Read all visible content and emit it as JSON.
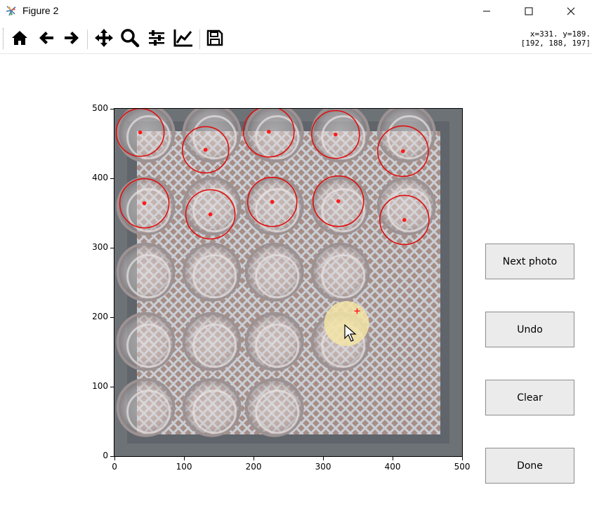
{
  "window": {
    "title": "Figure 2",
    "minimize_icon": "minimize-icon",
    "maximize_icon": "maximize-icon",
    "close_icon": "close-icon"
  },
  "toolbar": {
    "tools": [
      "home-icon",
      "back-arrow-icon",
      "forward-arrow-icon",
      "pan-icon",
      "zoom-icon",
      "configure-subplots-icon",
      "edit-axes-icon",
      "save-icon"
    ],
    "coord_line1": "x=331. y=189.",
    "coord_line2": "[192, 188, 197]"
  },
  "plot": {
    "xticks": [
      "0",
      "100",
      "200",
      "300",
      "400",
      "500"
    ],
    "yticks": [
      "0",
      "100",
      "200",
      "300",
      "400",
      "500"
    ],
    "xlim": [
      0,
      500
    ],
    "ylim": [
      0,
      500
    ],
    "marker_color": "#ff1a1a",
    "circle_color": "#e01010",
    "marked_points": [
      {
        "x": 37,
        "y": 466,
        "r": 34
      },
      {
        "x": 131,
        "y": 441,
        "r": 33
      },
      {
        "x": 222,
        "y": 467,
        "r": 36
      },
      {
        "x": 318,
        "y": 463,
        "r": 34
      },
      {
        "x": 415,
        "y": 439,
        "r": 36
      },
      {
        "x": 43,
        "y": 364,
        "r": 35
      },
      {
        "x": 138,
        "y": 348,
        "r": 35
      },
      {
        "x": 227,
        "y": 366,
        "r": 35
      },
      {
        "x": 322,
        "y": 367,
        "r": 36
      },
      {
        "x": 417,
        "y": 340,
        "r": 35
      }
    ],
    "cursor_point": {
      "x": 349,
      "y": 209
    }
  },
  "buttons": {
    "next": "Next photo",
    "undo": "Undo",
    "clear": "Clear",
    "done": "Done"
  }
}
